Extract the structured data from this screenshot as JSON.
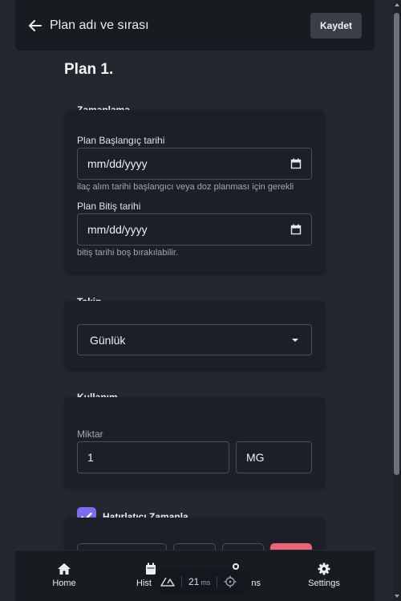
{
  "header": {
    "title": "Plan adı ve sırası",
    "save_label": "Kaydet"
  },
  "plan_title": "Plan 1.",
  "schedule": {
    "section_label": "Zamanlama",
    "start_label": "Plan Başlangıç tarihi",
    "start_value": "mm/dd/yyyy",
    "start_helper": "ilaç alım tarihi başlangıcı veya doz planması için gerekli",
    "end_label": "Plan Bitiş tarihi",
    "end_value": "mm/dd/yyyy",
    "end_helper": "bitiş tarihi boş bırakılabilir."
  },
  "tracking": {
    "section_label": "Takip",
    "selected": "Günlük"
  },
  "usage": {
    "section_label": "Kullanım",
    "amount_label": "Miktar",
    "amount_value": "1",
    "unit_value": "MG"
  },
  "reminder": {
    "label": "Hatırlatıcı Zamanla",
    "checked": true
  },
  "nav": {
    "items": [
      {
        "label": "Home",
        "icon": "home-icon"
      },
      {
        "label": "Hist",
        "icon": "calendar-icon"
      },
      {
        "label": "ons",
        "icon": "medication-icon"
      },
      {
        "label": "Settings",
        "icon": "gear-icon"
      }
    ]
  },
  "perf": {
    "value": "21",
    "unit": "ms"
  },
  "colors": {
    "accent": "#7c6cf2",
    "danger": "#f06277",
    "background": "#23272e"
  }
}
